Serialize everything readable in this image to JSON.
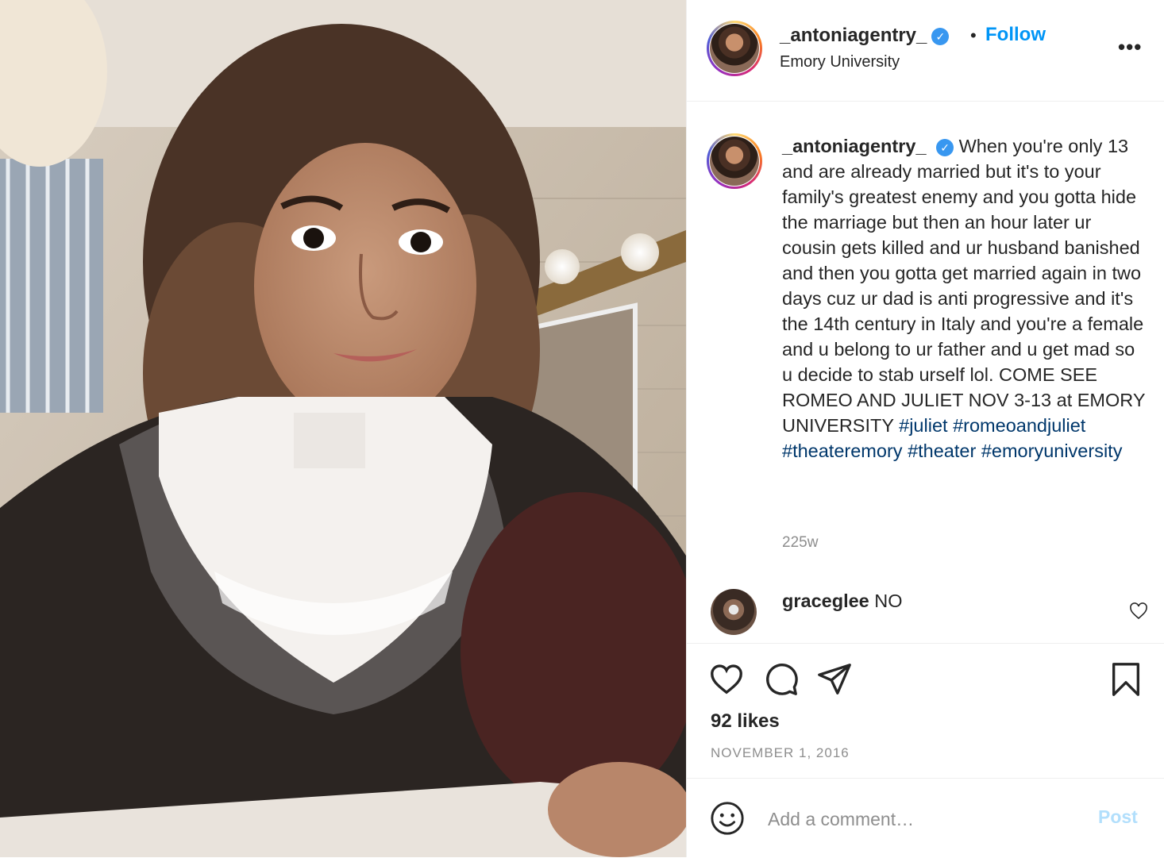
{
  "photo": {
    "icon": "post-photo"
  },
  "header": {
    "username": "_antoniagentry_",
    "verified_icon": "verified-badge-icon",
    "dot": "•",
    "follow_label": "Follow",
    "location": "Emory University",
    "more_label": "•••"
  },
  "caption": {
    "username": "_antoniagentry_",
    "text": "When you're only 13 and are already married but it's to your family's greatest enemy and you gotta hide the marriage but then an hour later ur cousin gets killed and ur husband banished and then you gotta get married again in two days cuz ur dad is anti progressive and it's the 14th century in Italy and you're a female and u belong to ur father and u get mad so u decide to stab urself lol. COME SEE ROMEO AND JULIET NOV 3-13 at EMORY UNIVERSITY",
    "hashtags": [
      "#juliet",
      "#romeoandjuliet",
      "#theateremory",
      "#theater",
      "#emoryuniversity"
    ],
    "time": "225w"
  },
  "comment": {
    "username": "graceglee",
    "text": "NO"
  },
  "actions": {
    "likes": "92 likes",
    "date": "NOVEMBER 1, 2016"
  },
  "add_comment": {
    "placeholder": "Add a comment…",
    "post_label": "Post"
  },
  "colors": {
    "accent": "#0095f6",
    "hashtag": "#00376b",
    "muted": "#8e8e8e",
    "post_disabled": "#b2dffc"
  }
}
